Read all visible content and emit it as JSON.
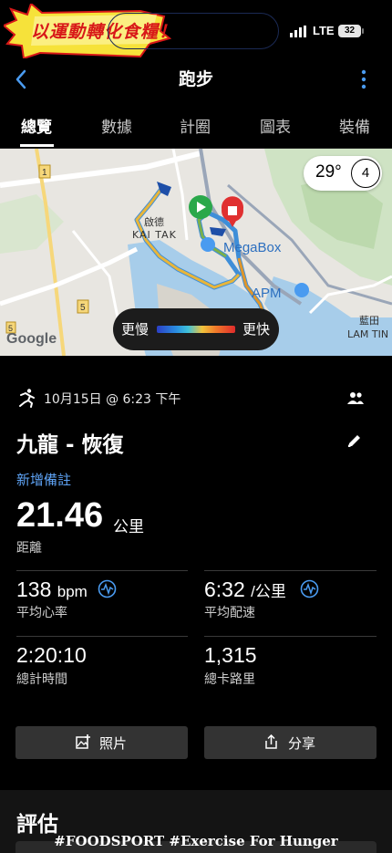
{
  "status_bar": {
    "banner_text": "以運動轉化食糧！",
    "network": "LTE",
    "battery": "32"
  },
  "nav": {
    "title": "跑步",
    "back_icon": "chevron-left-icon",
    "menu_icon": "kebab-menu-icon"
  },
  "tabs": [
    "總覽",
    "數據",
    "計圈",
    "圖表",
    "裝備"
  ],
  "map": {
    "temperature": "29°",
    "weather_badge": "4",
    "labels": {
      "kai_tak_cn": "啟德",
      "kai_tak": "KAI TAK",
      "megabox": "MegaBox",
      "apm": "APM",
      "lam_tin_cn": "藍田",
      "lam_tin": "LAM TIN",
      "route_1": "1",
      "route_5": "5",
      "route_5b": "5",
      "google": "Google"
    },
    "legend": {
      "slow": "更慢",
      "fast": "更快"
    }
  },
  "activity": {
    "date": "10月15日 @ 6:23 下午",
    "name": "九龍 - 恢復",
    "add_note": "新增備註",
    "distance": "21.46",
    "distance_unit": "公里",
    "distance_label": "距離"
  },
  "stats": {
    "avg_hr": "138",
    "avg_hr_unit": "bpm",
    "avg_hr_label": "平均心率",
    "avg_pace": "6:32",
    "avg_pace_unit": "/公里",
    "avg_pace_label": "平均配速",
    "total_time": "2:20:10",
    "total_time_label": "總計時間",
    "calories": "1,315",
    "calories_label": "總卡路里"
  },
  "buttons": {
    "photo": "照片",
    "share": "分享"
  },
  "evaluation": {
    "title": "評估"
  },
  "watermark": "#FOODSPORT #Exercise For Hunger"
}
